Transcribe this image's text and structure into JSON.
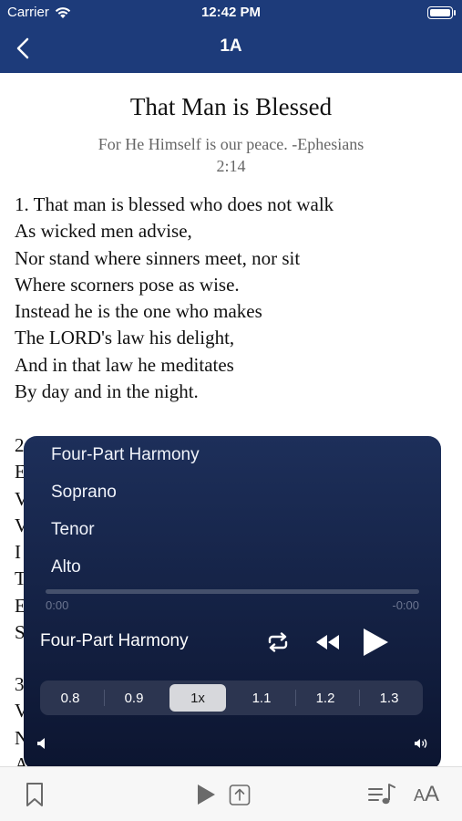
{
  "status_bar": {
    "carrier": "Carrier",
    "time": "12:42 PM"
  },
  "nav": {
    "title": "1A"
  },
  "song": {
    "title": "That Man is Blessed",
    "subtitle_line1": "For He Himself is our peace. -Ephesians",
    "subtitle_line2": "2:14",
    "verse1": [
      "1. That man is blessed who does not walk",
      "As wicked men advise,",
      "Nor stand where sinners meet, nor sit",
      "Where scorners pose as wise.",
      "Instead he is the one who makes",
      "The LORD's law his delight,",
      "And in that law he meditates",
      "By day and in the night."
    ],
    "verse2_visible": [
      "2",
      "E",
      "V",
      "V",
      "I",
      "T",
      "E",
      "S"
    ],
    "verse3_visible": [
      "3",
      "V",
      "N",
      "A"
    ]
  },
  "player": {
    "tracks": [
      "Four-Part Harmony",
      "Soprano",
      "Tenor",
      "Alto"
    ],
    "time_elapsed": "0:00",
    "time_remaining": "-0:00",
    "progress": 0,
    "now_playing": "Four-Part Harmony",
    "speed_options": [
      "0.8",
      "0.9",
      "1x",
      "1.1",
      "1.2",
      "1.3"
    ],
    "selected_speed": "1x",
    "icons": [
      "repeat-icon",
      "rewind-icon",
      "play-icon",
      "volume-low-icon",
      "volume-high-icon"
    ]
  },
  "toolbar": {
    "icons": [
      "bookmark-icon",
      "play-icon",
      "share-icon",
      "music-list-icon",
      "text-size-icon"
    ],
    "text_size_small": "A",
    "text_size_large": "A"
  },
  "colors": {
    "nav_bg": "#1d3b7a",
    "player_bg_top": "#1d2f5a",
    "player_bg_bottom": "#0c1530",
    "speed_selected_bg": "#d7d8dc",
    "toolbar_bg": "#f7f7f7"
  }
}
